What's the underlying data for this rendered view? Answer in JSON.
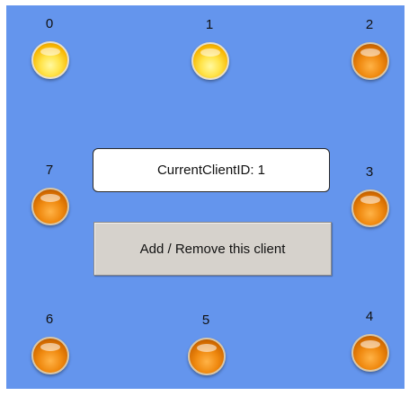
{
  "clients": [
    {
      "label": "0",
      "state": "on"
    },
    {
      "label": "1",
      "state": "on"
    },
    {
      "label": "2",
      "state": "off"
    },
    {
      "label": "3",
      "state": "off"
    },
    {
      "label": "4",
      "state": "off"
    },
    {
      "label": "5",
      "state": "off"
    },
    {
      "label": "6",
      "state": "off"
    },
    {
      "label": "7",
      "state": "off"
    }
  ],
  "current_client": {
    "text": "CurrentClientID: 1"
  },
  "action_button": {
    "label": "Add / Remove this client"
  },
  "colors": {
    "background": "#6495ED",
    "lamp_on": "#ffe44a",
    "lamp_off": "#f08a10",
    "button": "#d6d2cc"
  }
}
